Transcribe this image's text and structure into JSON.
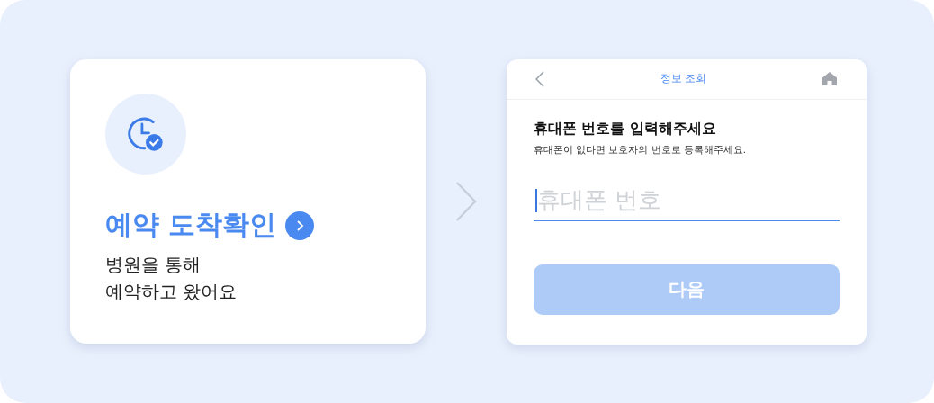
{
  "option_card": {
    "title": "예약 도착확인",
    "description": [
      "병원을 통해",
      "예약하고 왔어요"
    ]
  },
  "phone_screen": {
    "header": {
      "title": "정보 조회"
    },
    "heading": "휴대폰 번호를 입력해주세요",
    "subheading": "휴대폰이 없다면 보호자의 번호로 등록해주세요.",
    "phone_field": {
      "placeholder": "휴대폰 번호",
      "focused": true
    },
    "next_button": {
      "label": "다음",
      "disabled": true
    }
  }
}
